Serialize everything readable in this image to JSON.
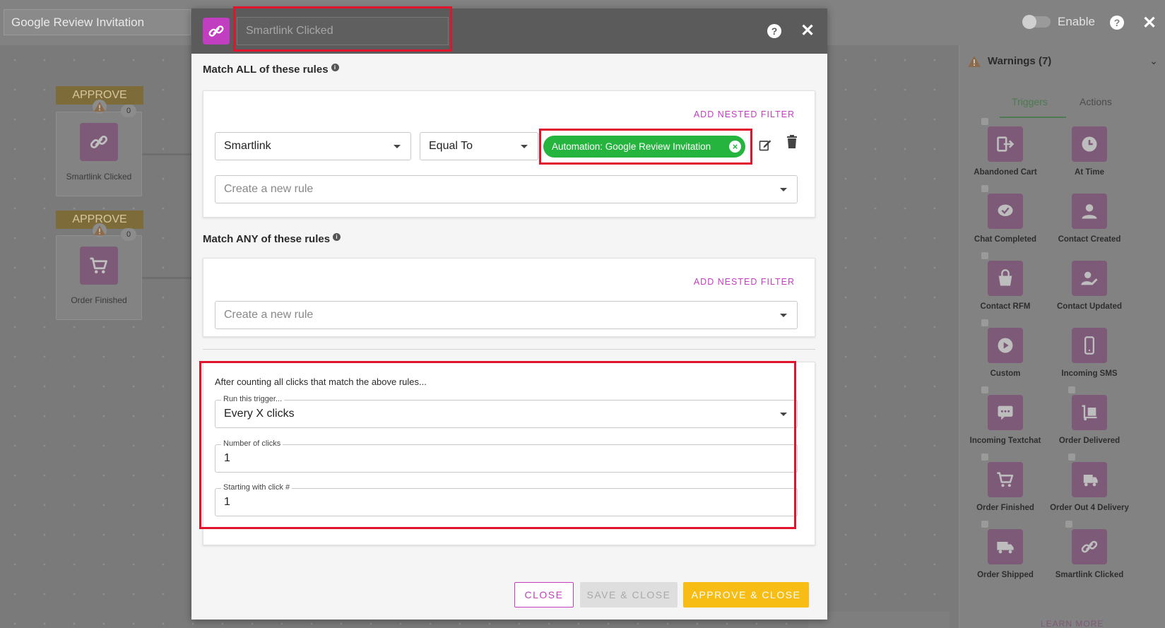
{
  "topbar": {
    "automation_name": "Google Review Invitation",
    "enable_label": "Enable",
    "help": "?",
    "close": "✕"
  },
  "canvas": {
    "nodes": [
      {
        "tag": "APPROVE",
        "label": "Smartlink Clicked",
        "count": "0"
      },
      {
        "tag": "APPROVE",
        "label": "Order Finished",
        "count": "0"
      }
    ]
  },
  "right_panel": {
    "warnings": "Warnings (7)",
    "tabs": [
      "Triggers",
      "Actions"
    ],
    "triggers": [
      "Abandoned Cart",
      "At Time",
      "Chat Completed",
      "Contact Created",
      "Contact RFM",
      "Contact Updated",
      "Custom",
      "Incoming SMS",
      "Incoming Textchat",
      "Order Delivered",
      "Order Finished",
      "Order Out 4 Delivery",
      "Order Shipped",
      "Smartlink Clicked"
    ],
    "learn_more": "LEARN MORE"
  },
  "modal": {
    "name_placeholder": "Smartlink Clicked",
    "help": "?",
    "close": "✕",
    "match_all_title": "Match ALL of these rules",
    "match_any_title": "Match ANY of these rules",
    "add_nested_filter": "ADD NESTED FILTER",
    "rule": {
      "field": "Smartlink",
      "operator": "Equal To",
      "value_chip": "Automation: Google Review Invitation"
    },
    "new_rule_placeholder": "Create a new rule",
    "count": {
      "intro": "After counting all clicks that match the above rules...",
      "trigger_label": "Run this trigger...",
      "trigger_value": "Every X clicks",
      "clicks_label": "Number of clicks",
      "clicks_value": "1",
      "start_label": "Starting with click #",
      "start_value": "1"
    },
    "buttons": {
      "close": "CLOSE",
      "save_close": "SAVE & CLOSE",
      "approve_close": "APPROVE & CLOSE"
    }
  },
  "colors": {
    "accent": "#c23ec0",
    "chip_green": "#25b53f",
    "approve_yellow": "#f8bd15",
    "highlight_red": "#e0142c"
  }
}
